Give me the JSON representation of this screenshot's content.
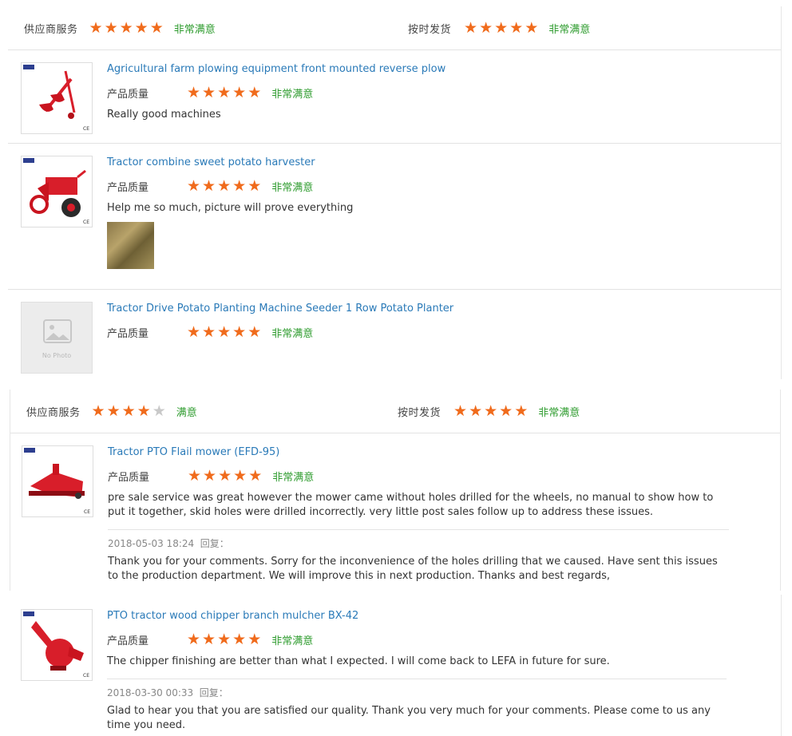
{
  "summary1": {
    "supplier_label": "供应商服务",
    "supplier_stars": 5,
    "supplier_text": "非常满意",
    "shipping_label": "按时发货",
    "shipping_stars": 5,
    "shipping_text": "非常满意"
  },
  "summary2": {
    "supplier_label": "供应商服务",
    "supplier_stars": 4,
    "supplier_text": "满意",
    "shipping_label": "按时发货",
    "shipping_stars": 5,
    "shipping_text": "非常满意"
  },
  "quality_label": "产品质量",
  "reviews": [
    {
      "title": "Agricultural farm plowing equipment front mounted reverse plow",
      "stars": 5,
      "rating_text": "非常满意",
      "comment": "Really good machines"
    },
    {
      "title": "Tractor combine sweet potato harvester",
      "stars": 5,
      "rating_text": "非常满意",
      "comment": "Help me so much, picture will prove everything"
    },
    {
      "title": "Tractor Drive Potato Planting Machine Seeder 1 Row Potato Planter",
      "stars": 5,
      "rating_text": "非常满意",
      "no_photo_text": "No Photo"
    },
    {
      "title": "Tractor PTO Flail mower (EFD-95)",
      "stars": 5,
      "rating_text": "非常满意",
      "comment": "pre sale service was great however the mower came without holes drilled for the wheels, no manual to show how to put it together, skid holes were drilled incorrectly. very little post sales follow up to address these issues.",
      "reply_date": "2018-05-03 18:24",
      "reply_label": "回复：",
      "reply": "Thank you for your comments. Sorry for the inconvenience of the holes drilling that we caused. Have sent this issues to the production department. We will improve this in next production. Thanks and best regards,"
    },
    {
      "title": "PTO tractor wood chipper branch mulcher BX-42",
      "stars": 5,
      "rating_text": "非常满意",
      "comment": "The chipper finishing are better than what I expected. I will come back to LEFA in future for sure.",
      "reply_date": "2018-03-30 00:33",
      "reply_label": "回复：",
      "reply": "Glad to hear you that you are satisfied our quality. Thank you very much for your comments. Please come to us any time you need."
    }
  ],
  "colors": {
    "star_on": "#f06b1c",
    "star_off": "#c9c9c9",
    "rating_text": "#2f9c2f",
    "link": "#2a7ab8"
  }
}
